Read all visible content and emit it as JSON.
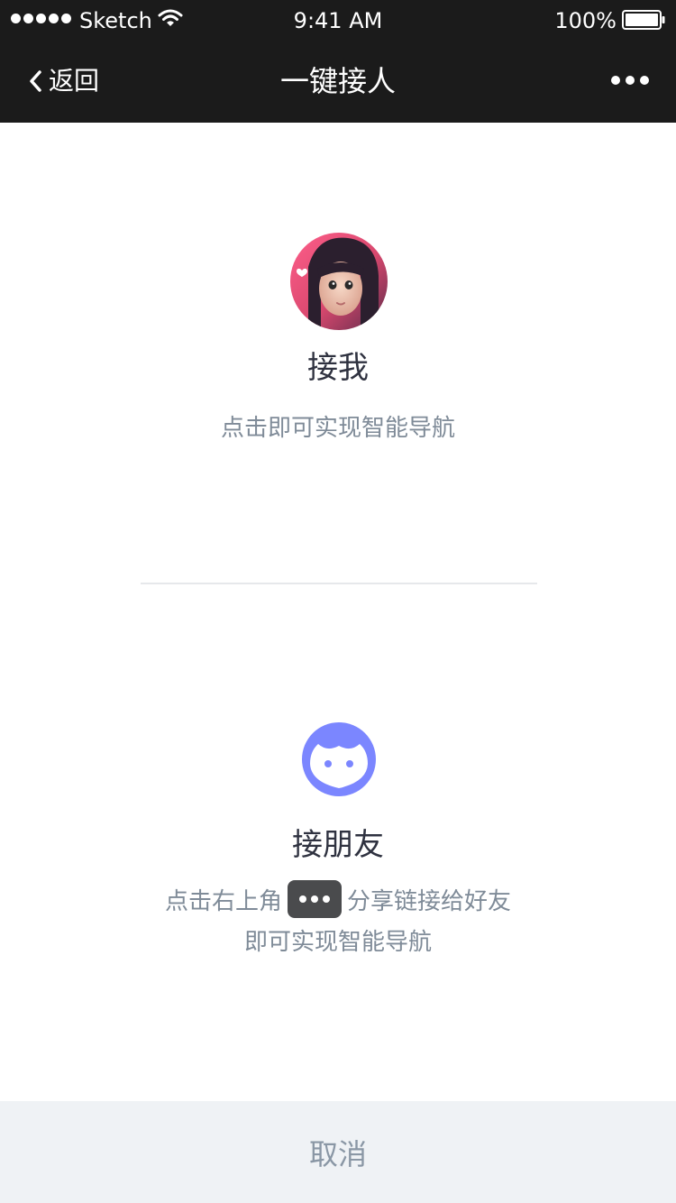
{
  "status_bar": {
    "carrier": "Sketch",
    "time": "9:41 AM",
    "battery": "100%",
    "signal_icon": "signal-dots-icon",
    "wifi_icon": "wifi-icon",
    "battery_icon": "battery-icon"
  },
  "nav": {
    "back_label": "返回",
    "title": "一键接人",
    "back_icon": "chevron-left-icon",
    "more_icon": "more-dots-icon"
  },
  "pickup_me": {
    "title": "接我",
    "subtitle": "点击即可实现智能导航",
    "avatar_icon": "avatar-photo"
  },
  "pickup_friend": {
    "title": "接朋友",
    "line1_before": "点击右上角",
    "line1_after": "分享链接给好友",
    "line2": "即可实现智能导航",
    "icon": "friend-face-icon",
    "inline_icon": "more-dots-icon"
  },
  "footer": {
    "cancel_label": "取消"
  },
  "colors": {
    "topbar": "#1b1b1b",
    "title_text": "#2f3240",
    "secondary_text": "#7f8b98",
    "friend_icon": "#7b86ff",
    "cancel_bg": "#eff2f5",
    "cancel_text": "#8a97a5"
  }
}
